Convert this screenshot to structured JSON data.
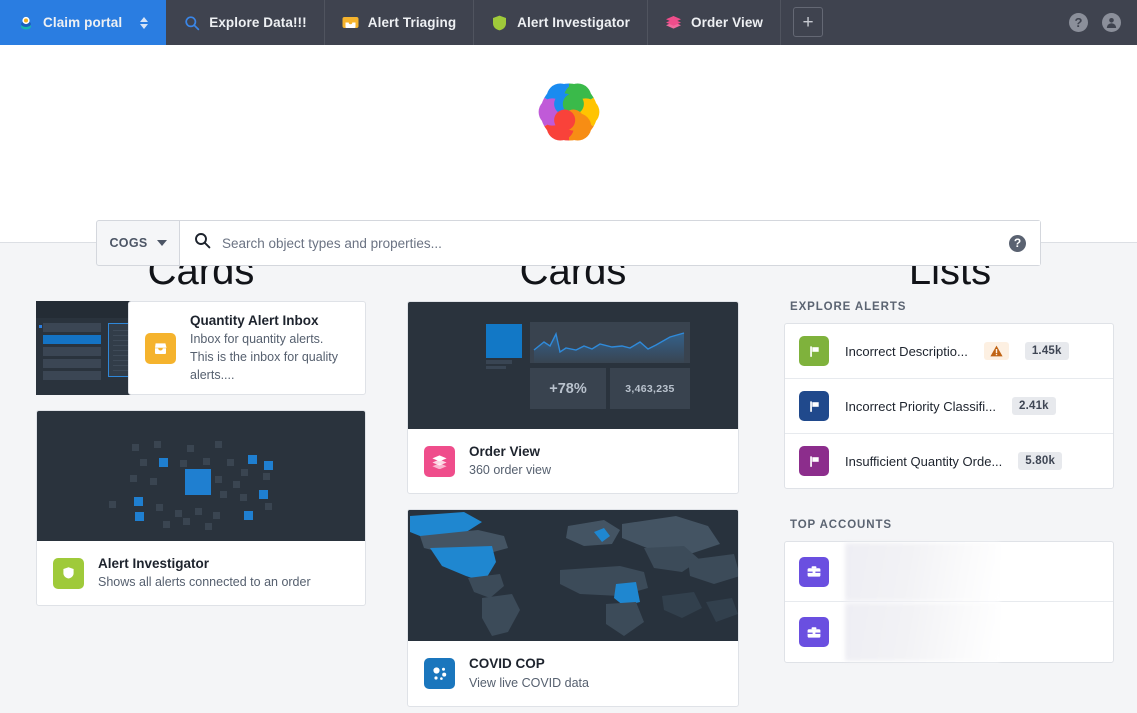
{
  "header": {
    "tabs": [
      {
        "label": "Claim portal",
        "icon": "target-logo-icon",
        "active": true,
        "has_switcher": true
      },
      {
        "label": "Explore Data!!!",
        "icon": "search-icon",
        "active": false,
        "has_switcher": false
      },
      {
        "label": "Alert Triaging",
        "icon": "inbox-icon",
        "active": false,
        "has_switcher": false
      },
      {
        "label": "Alert Investigator",
        "icon": "shield-icon",
        "active": false,
        "has_switcher": false
      },
      {
        "label": "Order View",
        "icon": "layers-icon",
        "active": false,
        "has_switcher": false
      }
    ],
    "add_tab_label": "+",
    "help_label": "?",
    "account_label": "●",
    "active_tab_color": "#2a7de1",
    "background_color": "#3f434f"
  },
  "search": {
    "scope_label": "COGS",
    "placeholder": "Search object types and properties...",
    "value": "",
    "help_label": "?"
  },
  "columns": {
    "left": {
      "heading": "Cards",
      "cards": [
        {
          "title": "Quantity Alert Inbox",
          "subtitle": "Inbox for quantity alerts. This is the inbox for quality alerts....",
          "icon": "inbox-icon",
          "icon_color": "#f5b32d",
          "layout": "row"
        },
        {
          "title": "Alert Investigator",
          "subtitle": "Shows all alerts connected to an order",
          "icon": "shield-icon",
          "icon_color": "#9fca3a",
          "layout": "stacked"
        }
      ]
    },
    "middle": {
      "heading": "Cards",
      "cards": [
        {
          "title": "Order View",
          "subtitle": "360 order view",
          "icon": "layers-icon",
          "icon_color": "#ef4d8b",
          "layout": "stacked",
          "thumb_kpi_percent": "+78%",
          "thumb_kpi_count": "3,463,235"
        },
        {
          "title": "COVID COP",
          "subtitle": "View live COVID data",
          "icon": "molecule-icon",
          "icon_color": "#1a76bd",
          "layout": "stacked"
        }
      ]
    },
    "right": {
      "heading": "Lists",
      "sections": [
        {
          "label": "EXPLORE ALERTS",
          "rows": [
            {
              "name": "Incorrect Descriptio...",
              "icon": "flag-icon",
              "icon_color": "#7fb23c",
              "warning": true,
              "count": "1.45k"
            },
            {
              "name": "Incorrect Priority Classifi...",
              "icon": "flag-icon",
              "icon_color": "#20498c",
              "warning": false,
              "count": "2.41k"
            },
            {
              "name": "Insufficient Quantity Orde...",
              "icon": "flag-icon",
              "icon_color": "#8c2d8c",
              "warning": false,
              "count": "5.80k"
            }
          ]
        },
        {
          "label": "TOP ACCOUNTS",
          "rows": [
            {
              "name": "",
              "icon": "briefcase-icon",
              "icon_color": "#6a4fe0",
              "warning": false,
              "count": "",
              "loading": true
            },
            {
              "name": "",
              "icon": "briefcase-icon",
              "icon_color": "#6a4fe0",
              "warning": false,
              "count": "",
              "loading": true
            }
          ]
        }
      ]
    }
  }
}
